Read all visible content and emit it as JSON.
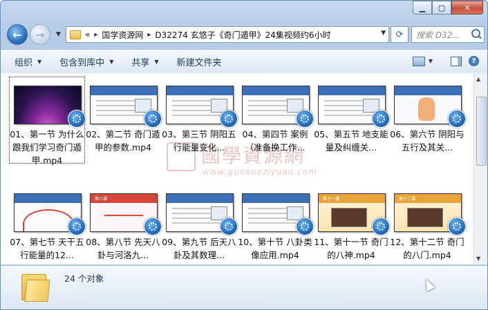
{
  "address": {
    "prefix": "«",
    "crumbs": [
      "国学资源网",
      "D32274 玄悠子《奇门遁甲》24集视频约6小时"
    ]
  },
  "search": {
    "placeholder": "搜索 D32..."
  },
  "toolbar": {
    "organize": "组织",
    "include": "包含到库中",
    "share": "共享",
    "new_folder": "新建文件夹"
  },
  "files": [
    {
      "label": "01、第一节 为什么跟我们学习奇门遁甲.mp4",
      "theme": "space",
      "title": ""
    },
    {
      "label": "02、第二节 奇门遁甲的参数.mp4",
      "theme": "blue",
      "title": ""
    },
    {
      "label": "03、第三节 阴阳五行能量变化...",
      "theme": "blue",
      "title": ""
    },
    {
      "label": "04、第四节 案例（准备换工作...",
      "theme": "blue",
      "title": ""
    },
    {
      "label": "05、第五节 地支能量及纠缠关...",
      "theme": "blue",
      "title": ""
    },
    {
      "label": "06、第六节 阴阳与五行及其关...",
      "theme": "hand",
      "title": ""
    },
    {
      "label": "07、第七节 天干五行能量的12...",
      "theme": "arc",
      "title": ""
    },
    {
      "label": "08、第八节 先天八卦与河洛九...",
      "theme": "red",
      "title": "第八课"
    },
    {
      "label": "09、第九节 后天八卦及其数理...",
      "theme": "blue",
      "title": ""
    },
    {
      "label": "10、第十节 八卦类像应用.mp4",
      "theme": "blue",
      "title": ""
    },
    {
      "label": "11、第十一节 奇门的八神.mp4",
      "theme": "amber",
      "title": "第十一课"
    },
    {
      "label": "12、第十二节 奇门的八门.mp4",
      "theme": "amber",
      "title": "第十二课"
    }
  ],
  "details": {
    "count": "24 个对象"
  },
  "watermark": {
    "cn": "國學資源網",
    "url": "www.guoxueziyuan.com"
  }
}
